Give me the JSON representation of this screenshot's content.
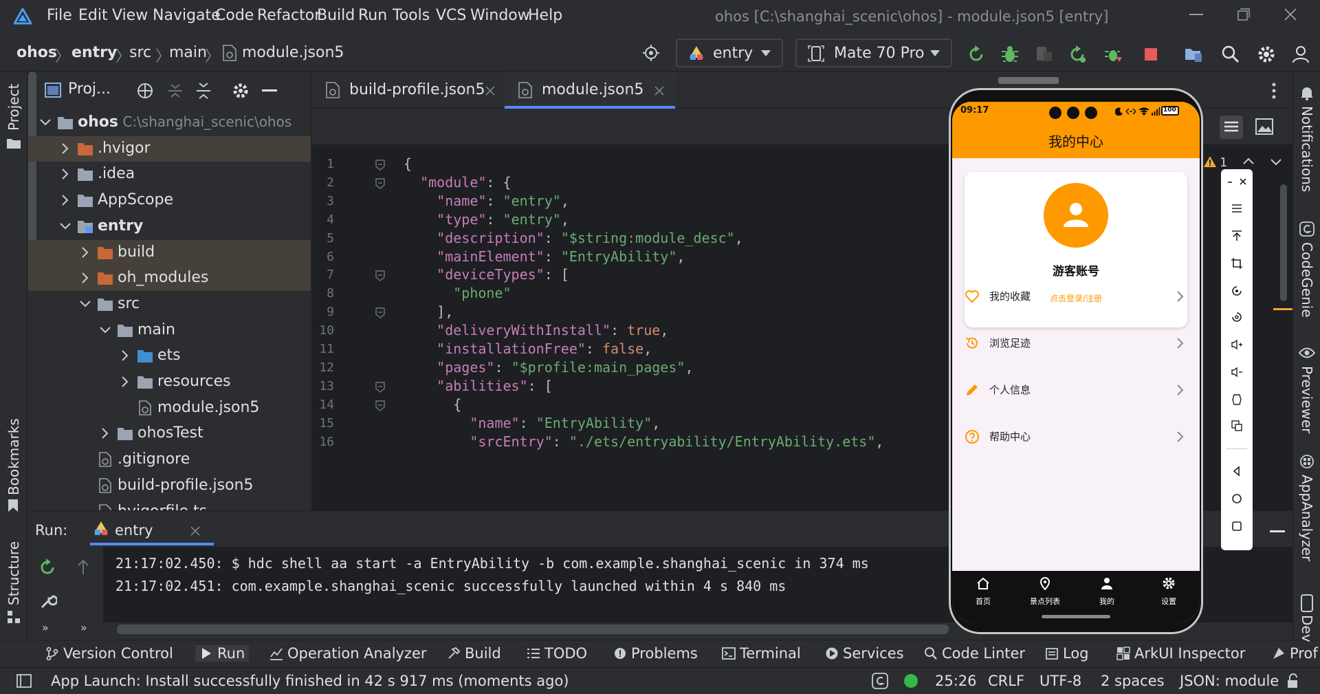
{
  "menu": [
    "File",
    "Edit",
    "View",
    "Navigate",
    "Code",
    "Refactor",
    "Build",
    "Run",
    "Tools",
    "VCS",
    "Window",
    "Help"
  ],
  "window_title": "ohos [C:\\shanghai_scenic\\ohos] - module.json5 [entry]",
  "breadcrumb": [
    "ohos",
    "entry",
    "src",
    "main",
    "module.json5"
  ],
  "run_config": "entry",
  "device": "Mate 70 Pro",
  "left_strip": {
    "project": "Project",
    "bookmarks": "Bookmarks",
    "structure": "Structure"
  },
  "project": {
    "header": "Proj...",
    "tree": [
      {
        "label": "ohos",
        "sub": "C:\\shanghai_scenic\\ohos",
        "type": "folder",
        "depth": 0,
        "expanded": true,
        "bold": true
      },
      {
        "label": ".hvigor",
        "type": "folder-orange",
        "depth": 1,
        "expanded": false,
        "hl": true
      },
      {
        "label": ".idea",
        "type": "folder",
        "depth": 1,
        "expanded": false
      },
      {
        "label": "AppScope",
        "type": "folder",
        "depth": 1,
        "expanded": false
      },
      {
        "label": "entry",
        "type": "folder-mod",
        "depth": 1,
        "expanded": true,
        "bold": true
      },
      {
        "label": "build",
        "type": "folder-orange",
        "depth": 2,
        "expanded": false,
        "hl": true
      },
      {
        "label": "oh_modules",
        "type": "folder-orange",
        "depth": 2,
        "expanded": false,
        "hl": true
      },
      {
        "label": "src",
        "type": "folder",
        "depth": 2,
        "expanded": true
      },
      {
        "label": "main",
        "type": "folder",
        "depth": 3,
        "expanded": true
      },
      {
        "label": "ets",
        "type": "folder-blue",
        "depth": 4,
        "expanded": false
      },
      {
        "label": "resources",
        "type": "folder",
        "depth": 4,
        "expanded": false
      },
      {
        "label": "module.json5",
        "type": "file",
        "depth": 4
      },
      {
        "label": "ohosTest",
        "type": "folder",
        "depth": 3,
        "expanded": false
      },
      {
        "label": ".gitignore",
        "type": "file",
        "depth": 2
      },
      {
        "label": "build-profile.json5",
        "type": "file",
        "depth": 2
      },
      {
        "label": "hvigorfile.ts",
        "type": "file",
        "depth": 2
      }
    ]
  },
  "editor_tabs": [
    {
      "label": "build-profile.json5",
      "active": false
    },
    {
      "label": "module.json5",
      "active": true
    }
  ],
  "inspection": {
    "count": "1"
  },
  "code_lines": [
    "{",
    "  \"module\": {",
    "    \"name\": \"entry\",",
    "    \"type\": \"entry\",",
    "    \"description\": \"$string:module_desc\",",
    "    \"mainElement\": \"EntryAbility\",",
    "    \"deviceTypes\": [",
    "      \"phone\"",
    "    ],",
    "    \"deliveryWithInstall\": true,",
    "    \"installationFree\": false,",
    "    \"pages\": \"$profile:main_pages\",",
    "    \"abilities\": [",
    "      {",
    "        \"name\": \"EntryAbility\",",
    "        \"srcEntry\": \"./ets/entryability/EntryAbility.ets\","
  ],
  "run": {
    "label": "Run:",
    "tab": "entry",
    "lines": [
      "21:17:02.450: $ hdc shell aa start -a EntryAbility -b com.example.shanghai_scenic in 374 ms",
      "21:17:02.451: com.example.shanghai_scenic successfully launched within 4 s 840 ms"
    ]
  },
  "bottom_tools": [
    "Version Control",
    "Run",
    "Operation Analyzer",
    "Build",
    "TODO",
    "Problems",
    "Terminal",
    "Services",
    "Code Linter",
    "Log",
    "ArkUI Inspector",
    "Prof"
  ],
  "status": {
    "message": "App Launch: Install successfully finished in 42 s 917 ms (moments ago)",
    "position": "25:26",
    "line_sep": "CRLF",
    "encoding": "UTF-8",
    "indent": "2 spaces",
    "schema": "JSON: module"
  },
  "right_strip": [
    "Notifications",
    "CodeGenie",
    "Previewer",
    "AppAnalyzer",
    "Dev"
  ],
  "phone": {
    "time": "09:17",
    "battery": "100",
    "title": "我的中心",
    "profile_name": "游客账号",
    "profile_action": "点击登录/注册",
    "menu_items": [
      {
        "label": "我的收藏",
        "icon": "heart-icon"
      },
      {
        "label": "浏览足迹",
        "icon": "history-icon"
      },
      {
        "label": "个人信息",
        "icon": "edit-icon"
      },
      {
        "label": "帮助中心",
        "icon": "help-icon"
      }
    ],
    "tabs": [
      {
        "label": "首页",
        "icon": "home-icon"
      },
      {
        "label": "景点列表",
        "icon": "location-icon"
      },
      {
        "label": "我的",
        "icon": "person-icon"
      },
      {
        "label": "设置",
        "icon": "gear-icon"
      }
    ],
    "accent": "#ff9900"
  }
}
